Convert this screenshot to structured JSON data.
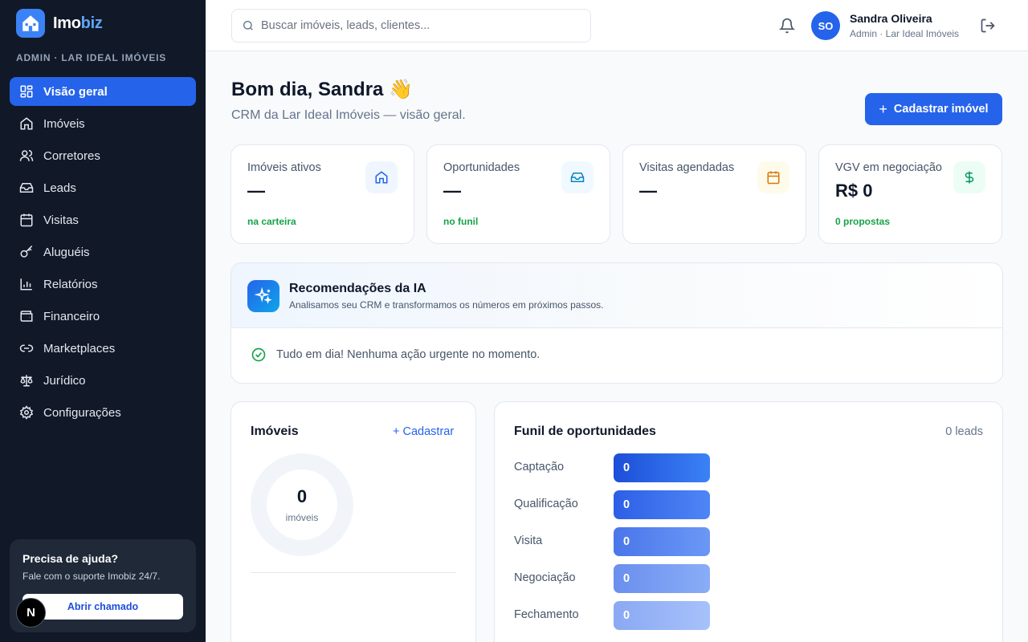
{
  "brand": {
    "name_main": "Imo",
    "name_accent": "biz",
    "org": "ADMIN · LAR IDEAL IMÓVEIS"
  },
  "sidebar": {
    "items": [
      {
        "label": "Visão geral",
        "icon": "grid-icon",
        "active": true
      },
      {
        "label": "Imóveis",
        "icon": "home-icon"
      },
      {
        "label": "Corretores",
        "icon": "users-icon"
      },
      {
        "label": "Leads",
        "icon": "inbox-icon"
      },
      {
        "label": "Visitas",
        "icon": "calendar-icon"
      },
      {
        "label": "Aluguéis",
        "icon": "key-icon"
      },
      {
        "label": "Relatórios",
        "icon": "bar-chart-icon"
      },
      {
        "label": "Financeiro",
        "icon": "wallet-icon"
      },
      {
        "label": "Marketplaces",
        "icon": "link-icon"
      },
      {
        "label": "Jurídico",
        "icon": "scale-icon"
      },
      {
        "label": "Configurações",
        "icon": "gear-icon"
      }
    ],
    "help": {
      "title": "Precisa de ajuda?",
      "subtitle": "Fale com o suporte Imobiz 24/7.",
      "button": "Abrir chamado"
    },
    "badge": "N"
  },
  "header": {
    "search_placeholder": "Buscar imóveis, leads, clientes...",
    "user": {
      "initials": "SO",
      "name": "Sandra Oliveira",
      "role": "Admin · Lar Ideal Imóveis"
    }
  },
  "main": {
    "greeting": "Bom dia, Sandra 👋",
    "subtitle": "CRM da Lar Ideal Imóveis — visão geral.",
    "primary_button": "Cadastrar imóvel",
    "stats": [
      {
        "label": "Imóveis ativos",
        "value": "—",
        "note": "na carteira",
        "icon": "home-icon",
        "tint": "#eff6ff",
        "color": "#2563eb"
      },
      {
        "label": "Oportunidades",
        "value": "—",
        "note": "no funil",
        "icon": "inbox-icon",
        "tint": "#f0f9ff",
        "color": "#0284c7"
      },
      {
        "label": "Visitas agendadas",
        "value": "—",
        "note": "",
        "icon": "calendar-icon",
        "tint": "#fffbeb",
        "color": "#d97706"
      },
      {
        "label": "VGV em negociação",
        "value": "R$ 0",
        "note": "0 propostas",
        "icon": "dollar-icon",
        "tint": "#ecfdf5",
        "color": "#059669"
      }
    ],
    "ai": {
      "title": "Recomendações da IA",
      "subtitle": "Analisamos seu CRM e transformamos os números em próximos passos.",
      "status": "Tudo em dia! Nenhuma ação urgente no momento."
    },
    "imoveis": {
      "title": "Imóveis",
      "link": "+ Cadastrar",
      "total": "0",
      "unit": "imóveis"
    },
    "funnel": {
      "title": "Funil de oportunidades",
      "count": "0 leads",
      "stages": [
        {
          "label": "Captação",
          "value": "0",
          "color": "#2563eb"
        },
        {
          "label": "Qualificação",
          "value": "0",
          "color": "#3b6ff0"
        },
        {
          "label": "Visita",
          "value": "0",
          "color": "#5b86ef"
        },
        {
          "label": "Negociação",
          "value": "0",
          "color": "#7b9ef3"
        },
        {
          "label": "Fechamento",
          "value": "0",
          "color": "#93b4f8"
        }
      ]
    }
  }
}
